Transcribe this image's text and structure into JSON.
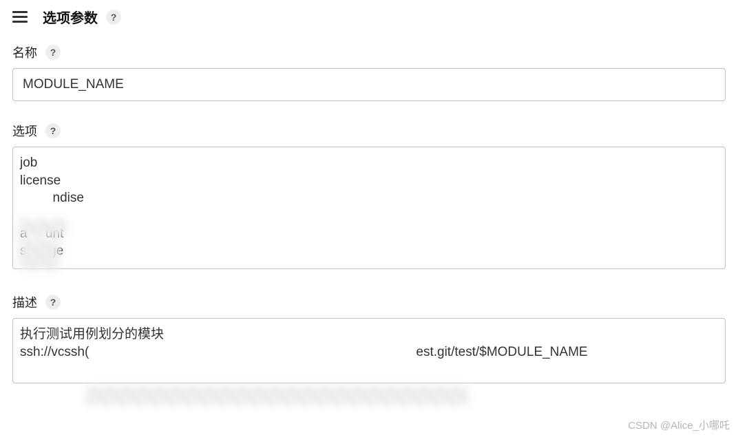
{
  "header": {
    "title": "选项参数",
    "help_tooltip": "?"
  },
  "fields": {
    "name": {
      "label": "名称",
      "help": "?",
      "value": "MODULE_NAME"
    },
    "options": {
      "label": "选项",
      "help": "?",
      "value": "job\nlicense\n         ndise\n\na     unt\nstorage"
    },
    "description": {
      "label": "描述",
      "help": "?",
      "value": "执行测试用例划分的模块\nssh://vcssh(                                                                                          est.git/test/$MODULE_NAME"
    }
  },
  "watermark": "CSDN @Alice_小哪吒"
}
